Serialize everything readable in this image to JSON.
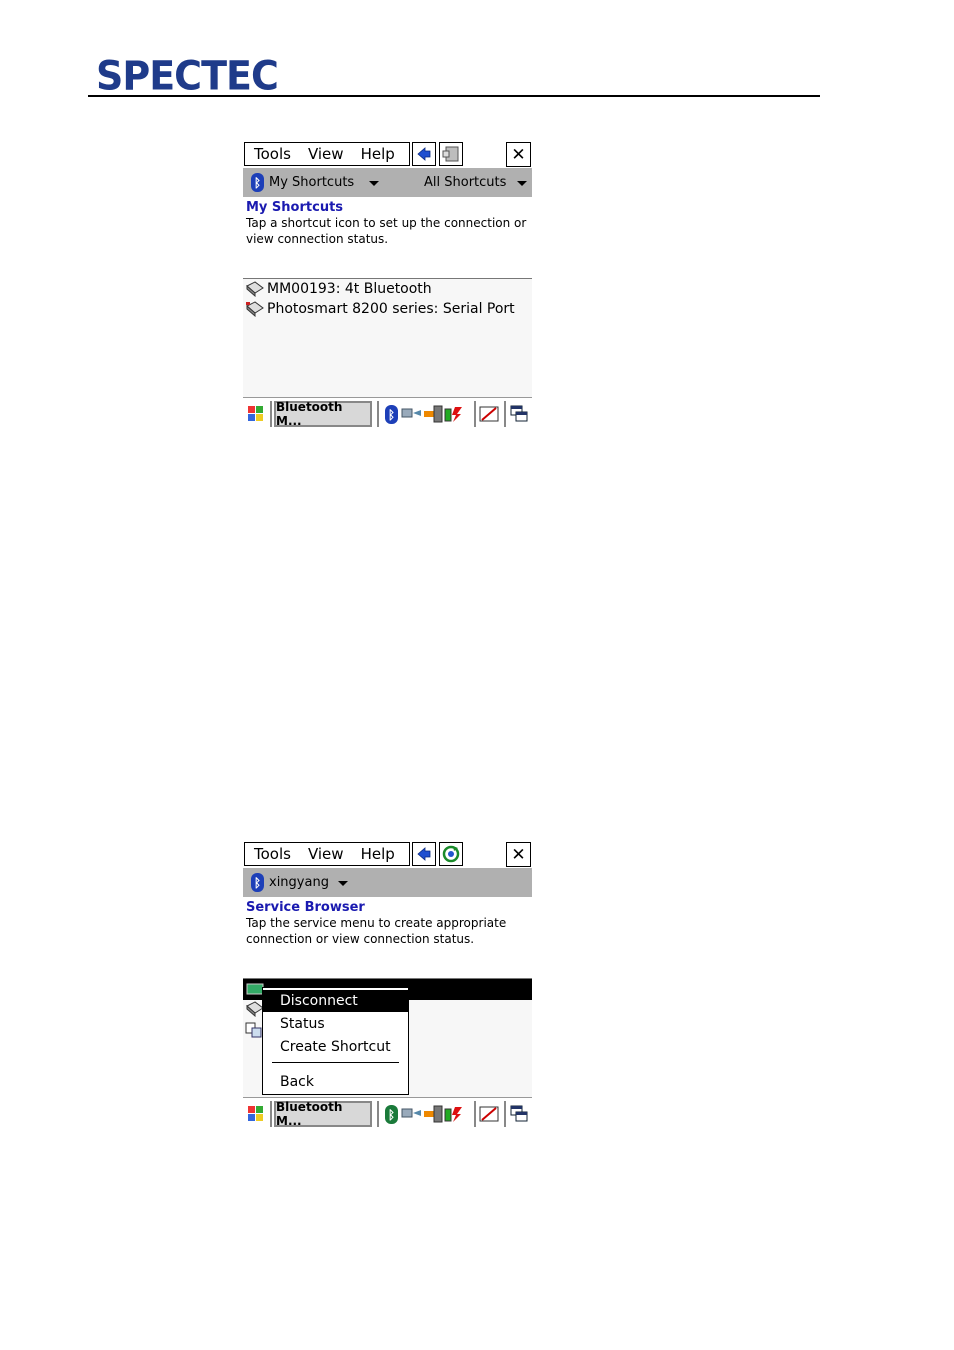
{
  "header": {
    "logo_text": "SPECTEC"
  },
  "menu": {
    "tools": "Tools",
    "view": "View",
    "help": "Help"
  },
  "screen1": {
    "bar_left_label": "My Shortcuts",
    "bar_right_label": "All Shortcuts",
    "section_title": "My Shortcuts",
    "section_text": "Tap a shortcut icon to set up the connection or view connection status.",
    "items": [
      "MM00193: 4t Bluetooth",
      "Photosmart 8200 series: Serial Port"
    ],
    "taskbar_button": "Bluetooth M..."
  },
  "screen2": {
    "bar_left_label": "xingyang",
    "section_title": "Service Browser",
    "section_text": "Tap the service menu to create appropriate connection or view connection status.",
    "context_menu": [
      "Disconnect",
      "Status",
      "Create Shortcut",
      "Back"
    ],
    "taskbar_button": "Bluetooth M..."
  },
  "colors": {
    "title_blue": "#1a1ab0",
    "logo_blue": "#1f3b8a",
    "bar_grey": "#b0b0b0",
    "bt_blue": "#1d3fb8"
  }
}
